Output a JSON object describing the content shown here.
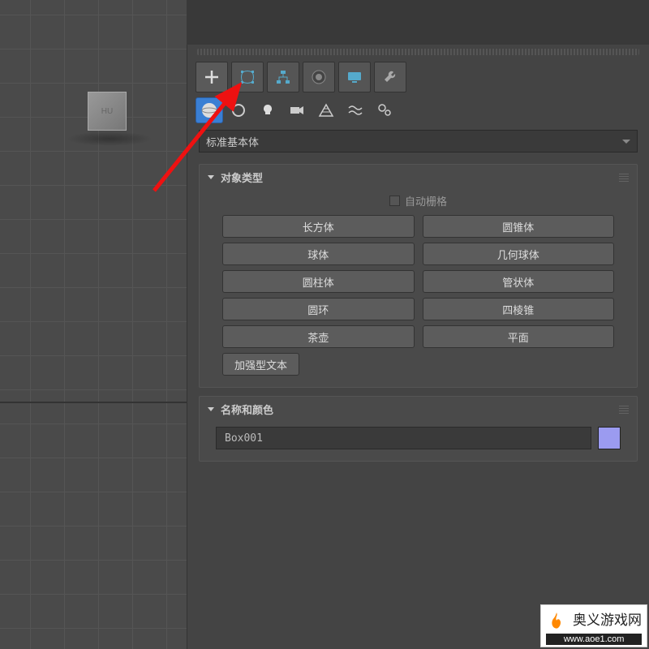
{
  "viewport": {
    "object_label": "HU"
  },
  "tabs": {
    "main": [
      "create",
      "modify",
      "hierarchy",
      "motion",
      "display",
      "utilities"
    ]
  },
  "dropdown": {
    "primitive_category": "标准基本体"
  },
  "rollouts": {
    "object_type": {
      "title": "对象类型",
      "autogrid_label": "自动栅格",
      "buttons": [
        "长方体",
        "圆锥体",
        "球体",
        "几何球体",
        "圆柱体",
        "管状体",
        "圆环",
        "四棱锥",
        "茶壶",
        "平面",
        "加强型文本"
      ]
    },
    "name_color": {
      "title": "名称和颜色",
      "name_value": "Box001",
      "color": "#9b9bf0"
    }
  },
  "watermark": {
    "text": "奥义游戏网",
    "url": "www.aoe1.com"
  }
}
